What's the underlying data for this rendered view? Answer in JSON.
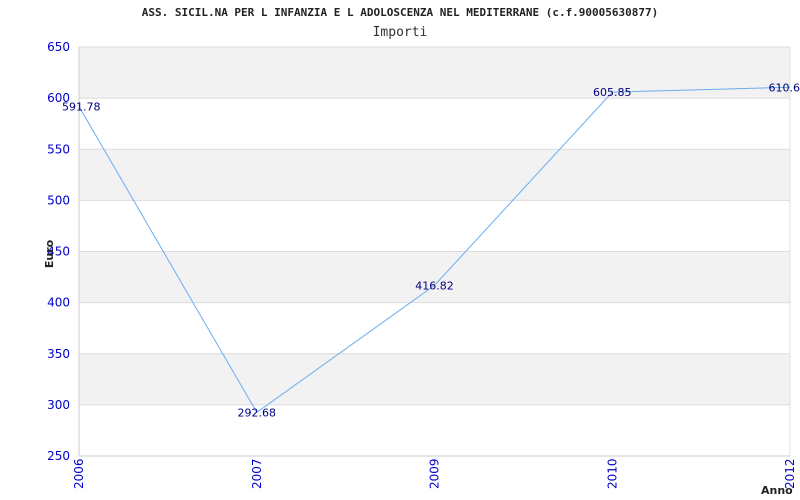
{
  "header": {
    "title": "ASS. SICIL.NA PER L INFANZIA E L ADOLOSCENZA NEL MEDITERRANE (c.f.90005630877)",
    "subtitle": "Importi"
  },
  "colors": {
    "line": "#6aaef0",
    "band": "#f2f2f2",
    "grid": "#dcdcdc",
    "tick": "#0000cc",
    "label": "#000080"
  },
  "chart_data": {
    "type": "line",
    "title": "Importi",
    "xlabel": "Anno",
    "ylabel": "Euro",
    "x": [
      "2006",
      "2007",
      "2009",
      "2010",
      "2012"
    ],
    "series": [
      {
        "values": [
          591.78,
          292.68,
          416.82,
          605.85,
          610.6
        ]
      }
    ],
    "data_labels": [
      "591.78",
      "292.68",
      "416.82",
      "605.85",
      "610.6"
    ],
    "ylim": [
      250,
      650
    ],
    "yticks": [
      250,
      300,
      350,
      400,
      450,
      500,
      550,
      600,
      650
    ],
    "grid": true,
    "legend": "none"
  }
}
